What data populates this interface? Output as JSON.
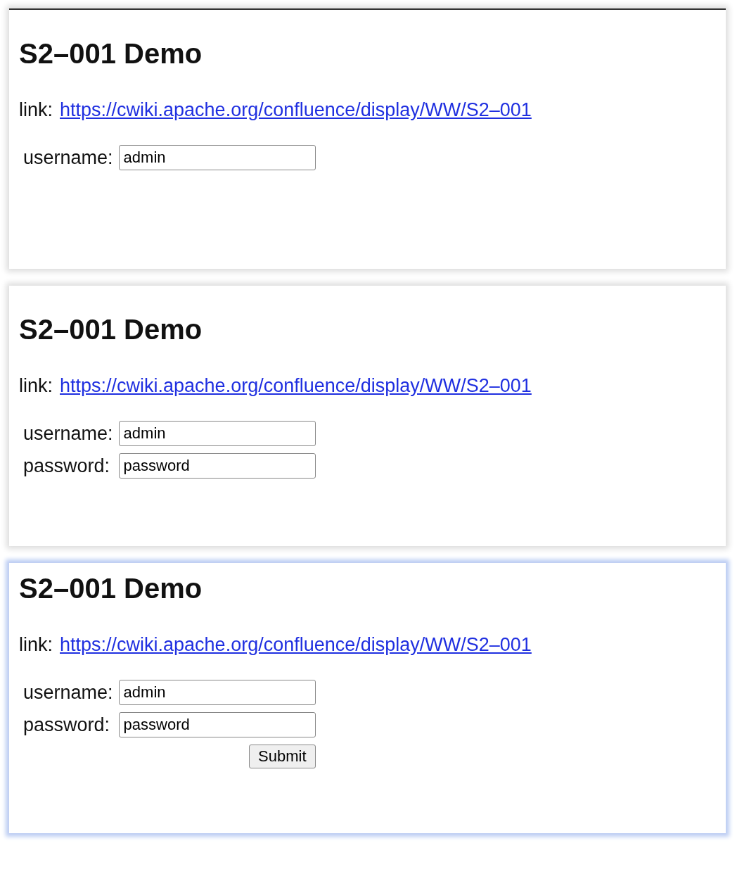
{
  "panels": [
    {
      "highlighted": false,
      "title": "S2–001 Demo",
      "link_label": "link:",
      "link": "https://cwiki.apache.org/confluence/display/WW/S2–001",
      "fields": [
        {
          "label": "username:",
          "value": "admin"
        }
      ]
    },
    {
      "highlighted": false,
      "title": "S2–001 Demo",
      "link_label": "link:",
      "link": "https://cwiki.apache.org/confluence/display/WW/S2–001",
      "fields": [
        {
          "label": "username:",
          "value": "admin"
        },
        {
          "label": "password:",
          "value": "password"
        }
      ]
    },
    {
      "highlighted": true,
      "title": "S2–001 Demo",
      "link_label": "link:",
      "link": "https://cwiki.apache.org/confluence/display/WW/S2–001",
      "fields": [
        {
          "label": "username:",
          "value": "admin"
        },
        {
          "label": "password:",
          "value": "password"
        }
      ],
      "submit": "Submit"
    }
  ]
}
